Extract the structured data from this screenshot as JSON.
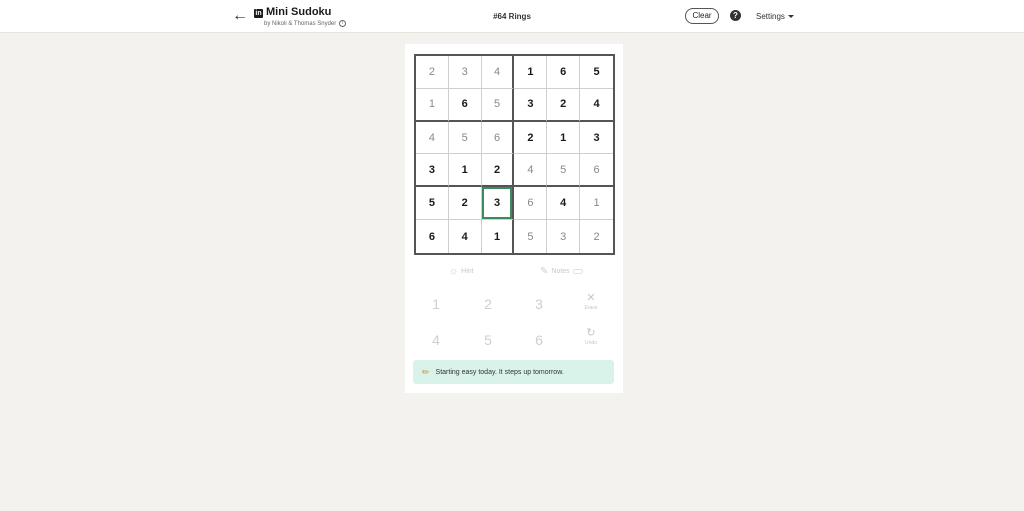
{
  "header": {
    "back_icon": "arrow-left-icon",
    "logo_text": "in",
    "title": "Mini Sudoku",
    "byline": "by Nikoli & Thomas Snyder",
    "puzzle": "#64 Rings",
    "clear_label": "Clear",
    "help_label": "?",
    "settings_label": "Settings"
  },
  "board": {
    "selected": [
      4,
      2
    ],
    "rows": [
      [
        {
          "v": "2",
          "g": false
        },
        {
          "v": "3",
          "g": false
        },
        {
          "v": "4",
          "g": false
        },
        {
          "v": "1",
          "g": true
        },
        {
          "v": "6",
          "g": true
        },
        {
          "v": "5",
          "g": true
        }
      ],
      [
        {
          "v": "1",
          "g": false
        },
        {
          "v": "6",
          "g": true
        },
        {
          "v": "5",
          "g": false
        },
        {
          "v": "3",
          "g": true
        },
        {
          "v": "2",
          "g": true
        },
        {
          "v": "4",
          "g": true
        }
      ],
      [
        {
          "v": "4",
          "g": false
        },
        {
          "v": "5",
          "g": false
        },
        {
          "v": "6",
          "g": false
        },
        {
          "v": "2",
          "g": true
        },
        {
          "v": "1",
          "g": true
        },
        {
          "v": "3",
          "g": true
        }
      ],
      [
        {
          "v": "3",
          "g": true
        },
        {
          "v": "1",
          "g": true
        },
        {
          "v": "2",
          "g": true
        },
        {
          "v": "4",
          "g": false
        },
        {
          "v": "5",
          "g": false
        },
        {
          "v": "6",
          "g": false
        }
      ],
      [
        {
          "v": "5",
          "g": true
        },
        {
          "v": "2",
          "g": true
        },
        {
          "v": "3",
          "g": true
        },
        {
          "v": "6",
          "g": false
        },
        {
          "v": "4",
          "g": true
        },
        {
          "v": "1",
          "g": false
        }
      ],
      [
        {
          "v": "6",
          "g": true
        },
        {
          "v": "4",
          "g": true
        },
        {
          "v": "1",
          "g": true
        },
        {
          "v": "5",
          "g": false
        },
        {
          "v": "3",
          "g": false
        },
        {
          "v": "2",
          "g": false
        }
      ]
    ],
    "colors": {
      "given": "#1a1a1a",
      "entered": "#888888",
      "selected_border": "#3d8a5f"
    }
  },
  "tools": {
    "hint_label": "Hint",
    "notes_label": "Notes"
  },
  "keypad": {
    "keys": [
      "1",
      "2",
      "3",
      "4",
      "5",
      "6"
    ],
    "erase_label": "Erase",
    "undo_label": "Undo"
  },
  "banner": {
    "text": "Starting easy today. It steps up tomorrow.",
    "bg_color": "#d9f3ea"
  }
}
